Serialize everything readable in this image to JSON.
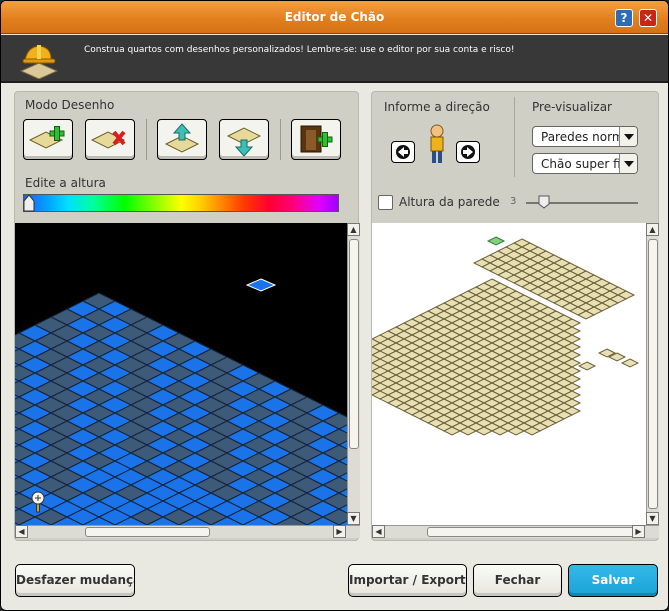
{
  "window": {
    "title": "Editor de Chão"
  },
  "titlebar": {
    "help_label": "?",
    "close_label": "✕"
  },
  "banner": {
    "message": "Construa quartos com desenhos personalizados! Lembre-se: use o editor por sua conta e risco!"
  },
  "left_panel": {
    "mode_label": "Modo Desenho",
    "height_label": "Edite a altura",
    "tools": [
      "add-tile-icon",
      "remove-tile-icon",
      "raise-height-icon",
      "lower-height-icon",
      "set-door-icon"
    ]
  },
  "right_panel": {
    "direction_label": "Informe a direção",
    "preview_label": "Pre-visualizar",
    "walls_select": "Paredes normais",
    "floor_select": "Chão super fino",
    "wall_height_label": "Altura da parede",
    "wall_height_value": "3",
    "wall_height_checked": false
  },
  "buttons": {
    "undo": "Desfazer mudanças",
    "import_export": "Importar / Exportar",
    "close": "Fechar",
    "save": "Salvar"
  },
  "colors": {
    "titlebar": "#e2801e",
    "primary_button": "#1aa3d6",
    "tile_blue": "#1a73e8",
    "tile_slate": "#3d5a78",
    "preview_tile": "#e8dfb4"
  }
}
